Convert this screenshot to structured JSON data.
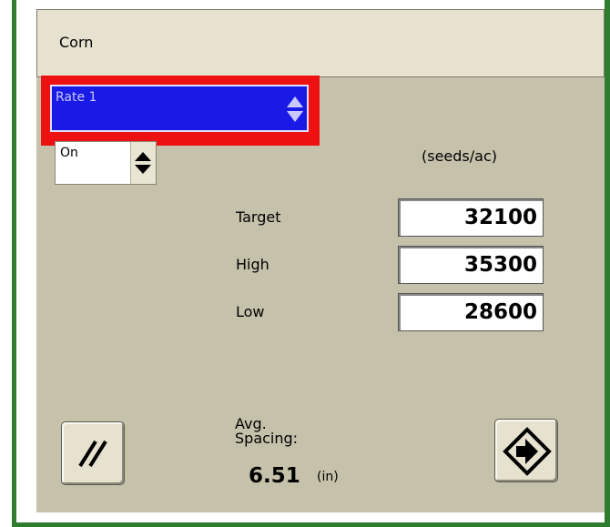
{
  "header": {
    "title": "Corn"
  },
  "rate_select": {
    "value": "Rate 1"
  },
  "state_select": {
    "value": "On"
  },
  "units_label": "(seeds/ac)",
  "rates": [
    {
      "label": "Target",
      "value": "32100"
    },
    {
      "label": "High",
      "value": "35300"
    },
    {
      "label": "Low",
      "value": "28600"
    }
  ],
  "avg_spacing": {
    "label_line1": "Avg.",
    "label_line2": "Spacing:",
    "value": "6.51",
    "unit": "(in)"
  },
  "icons": {
    "reset_button": "double-slash-icon",
    "next_button": "arrow-right-diamond-icon"
  },
  "colors": {
    "highlight": "#ee1111",
    "selected_dropdown": "#1a1ae6",
    "panel": "#c6c1ab",
    "header": "#e6e2cf",
    "frame": "#2e7d2e"
  }
}
